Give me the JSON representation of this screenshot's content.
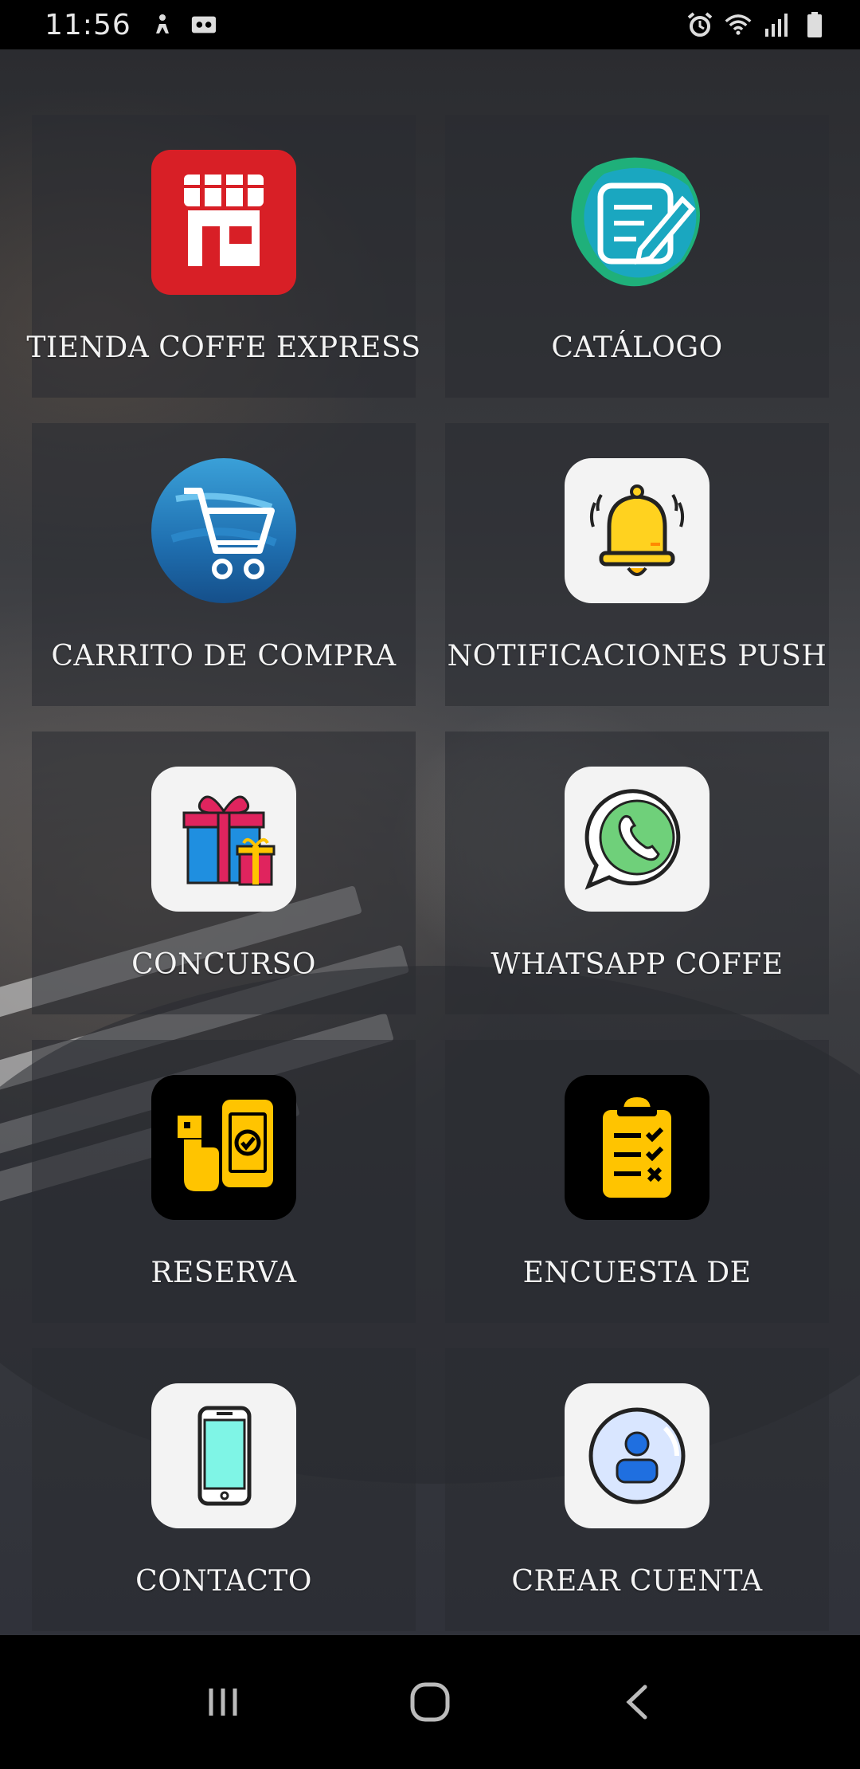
{
  "status_bar": {
    "time": "11:56",
    "left_icons": [
      "accessibility-icon",
      "voicemail-icon"
    ],
    "right_icons": [
      "alarm-icon",
      "wifi-icon",
      "signal-icon",
      "battery-icon"
    ]
  },
  "tiles": [
    {
      "label": "TIENDA COFFE EXPRESS",
      "icon": "store-icon"
    },
    {
      "label": "CATÁLOGO",
      "icon": "notepad-pencil-icon"
    },
    {
      "label": "CARRITO DE COMPRA",
      "icon": "shopping-cart-icon"
    },
    {
      "label": "NOTIFICACIONES PUSH",
      "icon": "bell-icon"
    },
    {
      "label": "CONCURSO",
      "icon": "gift-icon"
    },
    {
      "label": "WHATSAPP COFFE",
      "icon": "whatsapp-icon"
    },
    {
      "label": "RESERVA",
      "icon": "mobile-reservation-icon"
    },
    {
      "label": "ENCUESTA DE",
      "icon": "checklist-clipboard-icon"
    },
    {
      "label": "CONTACTO",
      "icon": "smartphone-icon"
    },
    {
      "label": "CREAR CUENTA",
      "icon": "user-profile-icon"
    }
  ],
  "nav_bar": {
    "buttons": [
      "recent-apps-icon",
      "home-icon",
      "back-icon"
    ]
  },
  "colors": {
    "store_red": "#d81f26",
    "catalog_teal": "#1aa7a8",
    "cart_blue": "#1f6fb0",
    "bell_yellow": "#ffd21f",
    "checklist_yellow": "#ffc400"
  }
}
